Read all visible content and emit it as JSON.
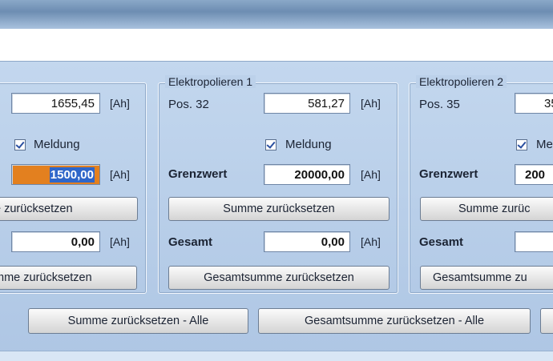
{
  "units": "[Ah]",
  "groups": [
    {
      "title": "",
      "pos_label": "",
      "pos_value": "1655,45",
      "meldung": "Meldung",
      "grenzwert_label": "",
      "grenzwert_value_selected": "1500,00",
      "summe_reset": "e zurücksetzen",
      "gesamt_label": "",
      "gesamt_value": "0,00",
      "gesamt_reset": "mme zurücksetzen"
    },
    {
      "title": "Elektropolieren 1",
      "pos_label": "Pos. 32",
      "pos_value": "581,27",
      "meldung": "Meldung",
      "grenzwert_label": "Grenzwert",
      "grenzwert_value": "20000,00",
      "summe_reset": "Summe zurücksetzen",
      "gesamt_label": "Gesamt",
      "gesamt_value": "0,00",
      "gesamt_reset": "Gesamtsumme zurücksetzen"
    },
    {
      "title": "Elektropolieren 2",
      "pos_label": "Pos. 35",
      "pos_value": "35",
      "meldung": "Me",
      "grenzwert_label": "Grenzwert",
      "grenzwert_value": "200",
      "summe_reset": "Summe zurüc",
      "gesamt_label": "Gesamt",
      "gesamt_value": "",
      "gesamt_reset": "Gesamtsumme zu"
    }
  ],
  "bottom": {
    "summe_all": "Summe zurücksetzen - Alle",
    "gesamt_all": "Gesamtsumme zurücksetzen - Alle"
  }
}
